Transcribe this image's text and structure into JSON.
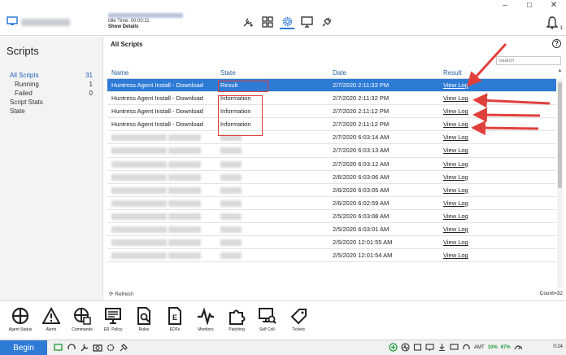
{
  "window": {
    "minimize": "–",
    "maximize": "□",
    "close": "✕"
  },
  "agent": {
    "uptime": "Idle Time: 00:00:11",
    "show_details": "Show Details"
  },
  "sidebar": {
    "title": "Scripts",
    "items": [
      {
        "label": "All Scripts",
        "count": "31",
        "active": true,
        "sub": false
      },
      {
        "label": "Running",
        "count": "1",
        "active": false,
        "sub": true
      },
      {
        "label": "Failed",
        "count": "0",
        "active": false,
        "sub": true
      },
      {
        "label": "Script Stats",
        "count": "",
        "active": false,
        "sub": false
      },
      {
        "label": "State",
        "count": "",
        "active": false,
        "sub": false
      }
    ]
  },
  "main": {
    "title": "All Scripts",
    "search_placeholder": "Search",
    "columns": {
      "name": "Name",
      "state": "State",
      "date": "Date",
      "result": "Result"
    },
    "rows": [
      {
        "name": "Huntress Agent Install - Download",
        "state": "Result",
        "date": "2/7/2020 2:11:33 PM",
        "result": "View Log",
        "selected": true
      },
      {
        "name": "Huntress Agent Install - Download",
        "state": "Information",
        "date": "2/7/2020 2:11:32 PM",
        "result": "View Log"
      },
      {
        "name": "Huntress Agent Install - Download",
        "state": "Information",
        "date": "2/7/2020 2:11:12 PM",
        "result": "View Log"
      },
      {
        "name": "Huntress Agent Install - Download",
        "state": "Information",
        "date": "2/7/2020 2:11:12 PM",
        "result": "View Log"
      },
      {
        "name": "",
        "state": "",
        "date": "2/7/2020 6:03:14 AM",
        "result": "View Log"
      },
      {
        "name": "",
        "state": "",
        "date": "2/7/2020 6:03:13 AM",
        "result": "View Log"
      },
      {
        "name": "",
        "state": "",
        "date": "2/7/2020 6:03:12 AM",
        "result": "View Log"
      },
      {
        "name": "",
        "state": "",
        "date": "2/6/2020 6:03:06 AM",
        "result": "View Log"
      },
      {
        "name": "",
        "state": "",
        "date": "2/6/2020 6:03:05 AM",
        "result": "View Log"
      },
      {
        "name": "",
        "state": "",
        "date": "2/6/2020 6:02:59 AM",
        "result": "View Log"
      },
      {
        "name": "",
        "state": "",
        "date": "2/5/2020 6:03:08 AM",
        "result": "View Log"
      },
      {
        "name": "",
        "state": "",
        "date": "2/5/2020 6:03:01 AM",
        "result": "View Log"
      },
      {
        "name": "",
        "state": "",
        "date": "2/5/2020 12:01:55 AM",
        "result": "View Log"
      },
      {
        "name": "",
        "state": "",
        "date": "2/5/2020 12:01:54 AM",
        "result": "View Log"
      }
    ],
    "refresh_label": "Refresh",
    "count_label": "Count=32"
  },
  "iconbar": [
    {
      "label": "Agent Status",
      "icon": "crosshair-icon"
    },
    {
      "label": "Alerts",
      "icon": "warning-icon"
    },
    {
      "label": "Commands",
      "icon": "command-icon"
    },
    {
      "label": "ER. Policy",
      "icon": "policy-icon"
    },
    {
      "label": "Roles",
      "icon": "roles-icon"
    },
    {
      "label": "EDFs",
      "icon": "edf-icon"
    },
    {
      "label": "Monitors",
      "icon": "pulse-icon"
    },
    {
      "label": "Patching",
      "icon": "puzzle-icon"
    },
    {
      "label": "Self Coll.",
      "icon": "self-service-icon"
    },
    {
      "label": "Tickets",
      "icon": "ticket-icon"
    }
  ],
  "taskbar": {
    "begin": "Begin",
    "cpu_label": "AMT",
    "pct1": "10%",
    "pct2": "67%",
    "clock": "0:24"
  },
  "colors": {
    "accent": "#2e7bd6",
    "annotation": "#e0403c"
  }
}
